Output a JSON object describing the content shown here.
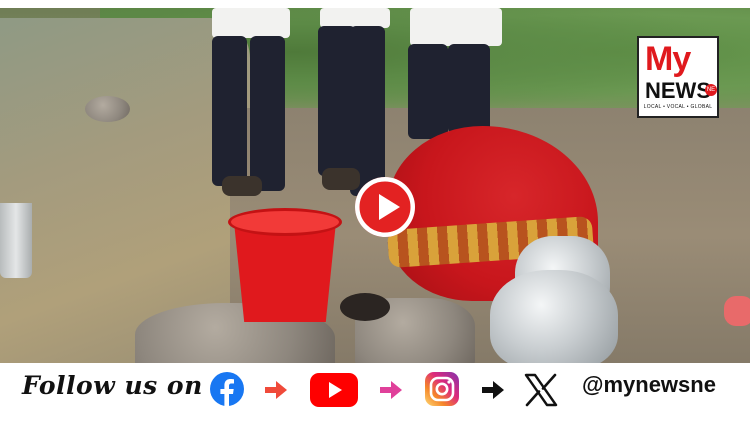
{
  "video": {
    "play_button_label": "Play video",
    "watermark": {
      "brand_main": "My",
      "brand_sub": "NEWS",
      "brand_badge": "NE",
      "tagline": "LOCAL • VOCAL • GLOBAL"
    }
  },
  "footer": {
    "follow_text": "Follow us on",
    "handle": "@mynewsne",
    "social_icons": [
      "facebook-icon",
      "youtube-icon",
      "instagram-icon",
      "x-icon"
    ],
    "colors": {
      "facebook": "#1877f2",
      "youtube": "#ff0000",
      "instagram_start": "#f58529",
      "instagram_end": "#8134af",
      "arrow_1": "#f04a3a",
      "arrow_2": "#e0409a",
      "arrow_3": "#111111"
    }
  },
  "colors": {
    "play_button": "#e32222",
    "brand_red": "#e0191d"
  }
}
